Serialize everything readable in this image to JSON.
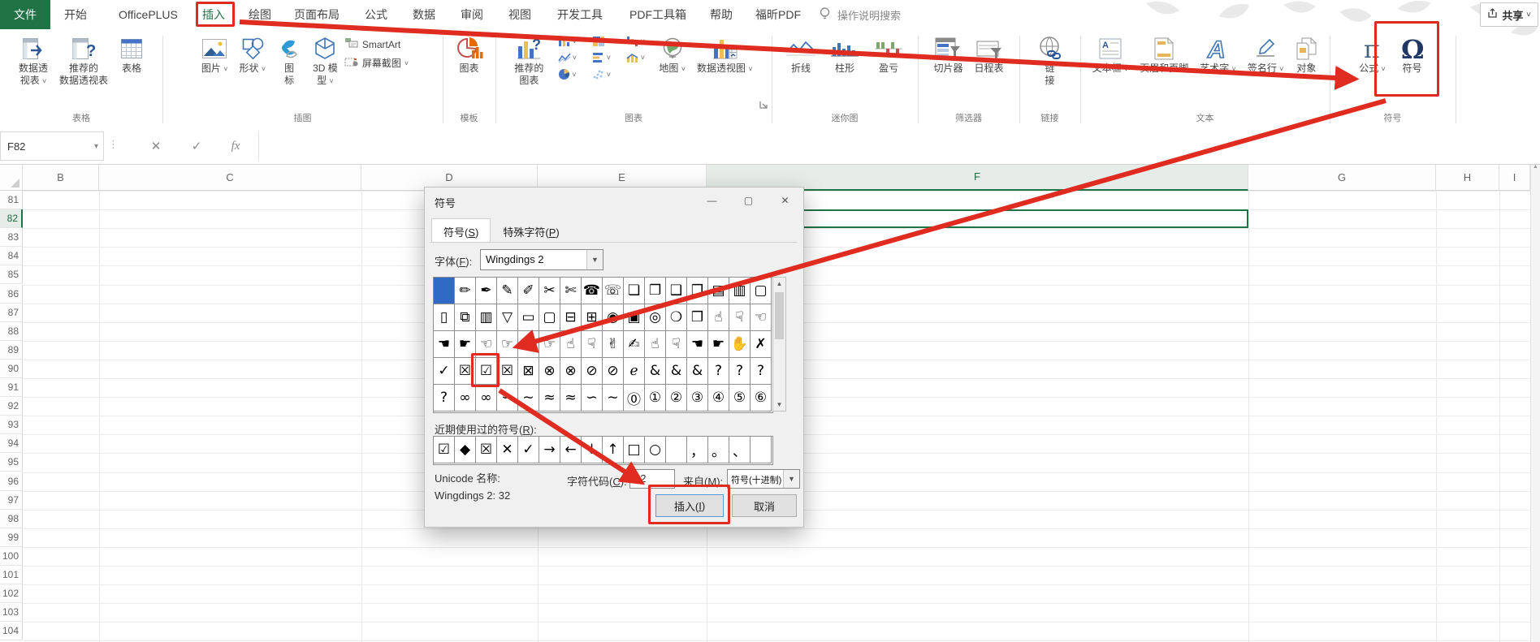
{
  "menu": {
    "file_label": "文件",
    "items": [
      "开始",
      "OfficePLUS",
      "插入",
      "绘图",
      "页面布局",
      "公式",
      "数据",
      "审阅",
      "视图",
      "开发工具",
      "PDF工具箱",
      "帮助",
      "福昕PDF"
    ],
    "active_item": "插入",
    "search_label": "操作说明搜索",
    "share_label": "共享"
  },
  "ribbon": {
    "groups": [
      {
        "label": "表格",
        "buttons": [
          {
            "name": "pivot-table",
            "icon": "pivot-table-icon",
            "lines": [
              "数据透",
              "视表"
            ],
            "caret": true
          },
          {
            "name": "recommended-pivot-tables",
            "icon": "recommended-pivot-icon",
            "lines": [
              "推荐的",
              "数据透视表"
            ]
          },
          {
            "name": "table",
            "icon": "table-icon",
            "lines": [
              "表格"
            ]
          }
        ]
      },
      {
        "label": "插图",
        "buttons": [
          {
            "name": "pictures",
            "icon": "picture-icon",
            "lines": [
              "图片"
            ],
            "caret": true
          },
          {
            "name": "shapes",
            "icon": "shapes-icon",
            "lines": [
              "形状"
            ],
            "caret": true
          },
          {
            "name": "icons",
            "icon": "icons-icon",
            "lines": [
              "图",
              "标"
            ]
          },
          {
            "name": "3d-models",
            "icon": "3d-model-icon",
            "lines": [
              "3D 模",
              "型"
            ],
            "caret": true
          },
          {
            "name": "smartart",
            "icon": "smartart-icon",
            "lines": [
              "SmartArt"
            ],
            "small": true
          },
          {
            "name": "screenshot",
            "icon": "screenshot-icon",
            "lines": [
              "屏幕截图"
            ],
            "caret": true,
            "small": true
          }
        ]
      },
      {
        "label": "模板",
        "buttons": [
          {
            "name": "chart-templates",
            "icon": "chart-pie-icon",
            "lines": [
              "图表"
            ]
          }
        ]
      },
      {
        "label": "图表",
        "buttons": [
          {
            "name": "recommended-charts",
            "icon": "recommended-chart-icon",
            "lines": [
              "推荐的",
              "图表"
            ]
          },
          {
            "name": "chart-type-buttons",
            "mini": true
          },
          {
            "name": "maps",
            "icon": "map-icon",
            "lines": [
              "地图"
            ],
            "caret": true
          },
          {
            "name": "pivot-chart",
            "icon": "pivot-chart-icon",
            "lines": [
              "数据透视图"
            ],
            "caret": true
          }
        ],
        "dialog_launcher": true
      },
      {
        "label": "迷你图",
        "buttons": [
          {
            "name": "line-sparkline",
            "icon": "sparkline-line-icon",
            "lines": [
              "折线"
            ]
          },
          {
            "name": "column-sparkline",
            "icon": "sparkline-column-icon",
            "lines": [
              "柱形"
            ]
          },
          {
            "name": "win-loss-sparkline",
            "icon": "winloss-icon",
            "lines": [
              "盈亏"
            ]
          }
        ]
      },
      {
        "label": "筛选器",
        "buttons": [
          {
            "name": "slicer",
            "icon": "slicer-icon",
            "lines": [
              "切片器"
            ]
          },
          {
            "name": "timeline",
            "icon": "timeline-icon",
            "lines": [
              "日程表"
            ]
          }
        ]
      },
      {
        "label": "链接",
        "buttons": [
          {
            "name": "link",
            "icon": "link-icon",
            "lines": [
              "链",
              "接"
            ]
          }
        ]
      },
      {
        "label": "文本",
        "buttons": [
          {
            "name": "text-box",
            "icon": "textbox-icon",
            "lines": [
              "文本框"
            ],
            "caret": true
          },
          {
            "name": "header-footer",
            "icon": "header-footer-icon",
            "lines": [
              "页眉和页脚"
            ]
          },
          {
            "name": "wordart",
            "icon": "wordart-icon",
            "lines": [
              "艺术字"
            ],
            "caret": true
          },
          {
            "name": "signature-line",
            "icon": "signature-icon",
            "lines": [
              "签名行"
            ],
            "caret": true
          },
          {
            "name": "object",
            "icon": "object-icon",
            "lines": [
              "对象"
            ]
          }
        ]
      },
      {
        "label": "符号",
        "buttons": [
          {
            "name": "equation",
            "icon": "pi-icon",
            "lines": [
              "公式"
            ],
            "caret": true
          },
          {
            "name": "symbol",
            "icon": "omega-icon",
            "lines": [
              "符号"
            ]
          }
        ]
      }
    ],
    "mini_chart_buttons": [
      "column-chart",
      "hierarchy-chart",
      "waterfall-chart",
      "line-chart",
      "bar-chart",
      "combo-chart",
      "pie-chart",
      "scatter-chart"
    ]
  },
  "formula_bar": {
    "name_box": "F82",
    "cancel_icon": "✕",
    "enter_icon": "✓",
    "fx_icon": "fx",
    "dropdown_icon": "▾",
    "dots_icon": "⋮"
  },
  "sheet": {
    "columns": [
      "B",
      "C",
      "D",
      "E",
      "F",
      "G",
      "H",
      "I"
    ],
    "rows": [
      81,
      82,
      83,
      84,
      85,
      86,
      87,
      88,
      89,
      90,
      91,
      92,
      93,
      94,
      95,
      96,
      97,
      98,
      99,
      100,
      101,
      102,
      103,
      104
    ],
    "selected_cell": "F82",
    "selected_column": "F",
    "selected_row": 82
  },
  "dialog": {
    "title": "符号",
    "window_controls": [
      {
        "name": "minimize-icon",
        "glyph": "—"
      },
      {
        "name": "maximize-icon",
        "glyph": "▢"
      },
      {
        "name": "close-icon",
        "glyph": "✕"
      }
    ],
    "tabs": [
      {
        "pre": "符号(",
        "key": "S",
        "suf": ")"
      },
      {
        "pre": "特殊字符(",
        "key": "P",
        "suf": ")"
      }
    ],
    "font_label": {
      "pre": "字体(",
      "key": "F",
      "suf": "):"
    },
    "font_value": "Wingdings 2",
    "symbol_grid": [
      [
        "",
        "✏",
        "✒",
        "✎",
        "✐",
        "✂",
        "✄",
        "☎",
        "☏",
        "❏",
        "❐",
        "❑",
        "❒",
        "▤",
        "▥",
        "▢"
      ],
      [
        "▯",
        "⧉",
        "▥",
        "▽",
        "▭",
        "▢",
        "⊟",
        "⊞",
        "◉",
        "▣",
        "◎",
        "❍",
        "❒",
        "☝",
        "☟",
        "☜"
      ],
      [
        "☚",
        "☛",
        "☜",
        "☞",
        "☜",
        "☞",
        "☝",
        "☟",
        "✌",
        "✍",
        "☝",
        "☟",
        "☚",
        "☛",
        "✋",
        "✗"
      ],
      [
        "✓",
        "☒",
        "☑",
        "☒",
        "⊠",
        "⊗",
        "⊗",
        "⊘",
        "⊘",
        "ℯ",
        "&",
        "&",
        "&",
        "?",
        "?",
        "?"
      ],
      [
        "?",
        "∞",
        "∞",
        "∽",
        "∼",
        "≈",
        "≈",
        "∽",
        "∼",
        "⓪",
        "①",
        "②",
        "③",
        "④",
        "⑤",
        "⑥"
      ]
    ],
    "selected_symbol_row": 0,
    "selected_symbol_col": 0,
    "highlighted_symbol_row": 3,
    "highlighted_symbol_col": 2,
    "scroll_up_icon": "▲",
    "scroll_down_icon": "▼",
    "recent_label": {
      "pre": "近期使用过的符号(",
      "key": "R",
      "suf": "):"
    },
    "recent_symbols": [
      "☑",
      "◆",
      "☒",
      "✕",
      "✓",
      "→",
      "←",
      "↓",
      "↑",
      "□",
      "○",
      "",
      "，",
      "。",
      "、",
      ""
    ],
    "unicode_name_label": "Unicode 名称:",
    "unicode_name_value": "Wingdings 2: 32",
    "char_code_label": {
      "pre": "字符代码(",
      "key": "C",
      "suf": "):"
    },
    "char_code_value": "32",
    "from_label": {
      "pre": "来自(",
      "key": "M",
      "suf": "):"
    },
    "from_value": "符号(十进制)",
    "insert_button": {
      "pre": "插入(",
      "key": "I",
      "suf": ")"
    },
    "cancel_button": "取消"
  },
  "annotations": {
    "color": "#e02b20",
    "highlights": [
      "insert-menu-tab",
      "symbol-ribbon-button",
      "boxed-check-symbol-cell",
      "dialog-insert-button"
    ]
  }
}
